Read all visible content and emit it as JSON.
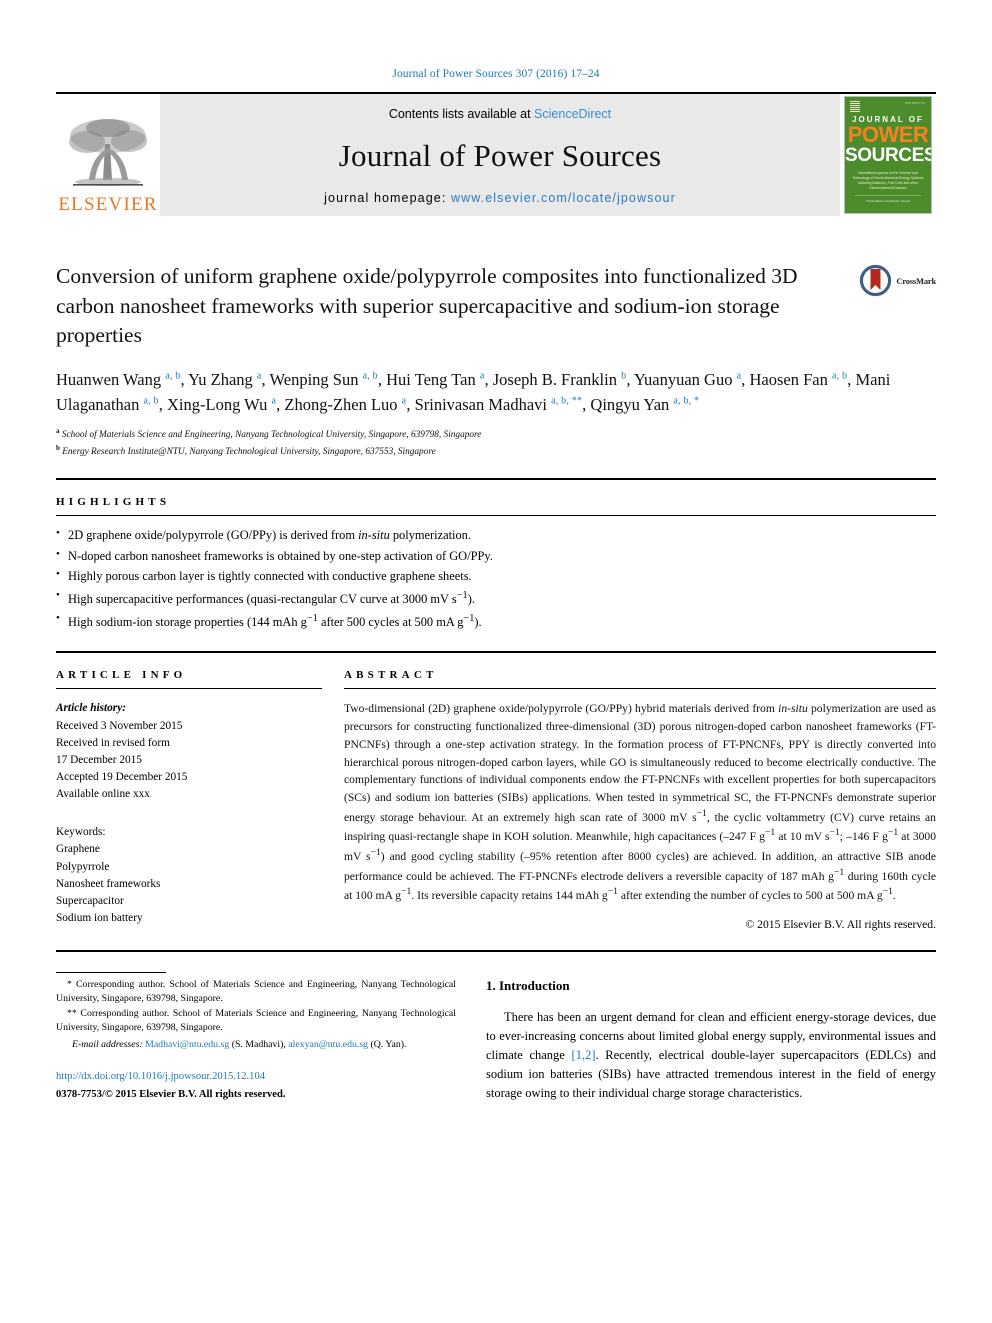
{
  "running_head": "Journal of Power Sources 307 (2016) 17–24",
  "masthead": {
    "publisher_name": "ELSEVIER",
    "contents_prefix": "Contents lists available at ",
    "contents_link": "ScienceDirect",
    "journal_name": "Journal of Power Sources",
    "homepage_prefix": "journal homepage: ",
    "homepage_url": "www.elsevier.com/locate/jpowsour",
    "cover": {
      "line1": "JOURNAL OF",
      "line2": "POWER",
      "line3": "SOURCES",
      "subtitle": "International journal on the Science and Technology of Electrochemical Energy Systems including Batteries, Fuel Cells and other Electrochemical Devices",
      "footer": "ScienceDirect\nAn Elsevier Journal"
    }
  },
  "article": {
    "title": "Conversion of uniform graphene oxide/polypyrrole composites into functionalized 3D carbon nanosheet frameworks with superior supercapacitive and sodium-ion storage properties",
    "crossmark_label": "CrossMark",
    "authors_html": "Huanwen Wang <sup class=\"aff-mark\">a, b</sup>, Yu Zhang <sup class=\"aff-mark\">a</sup>, Wenping Sun <sup class=\"aff-mark\">a, b</sup>, Hui Teng Tan <sup class=\"aff-mark\">a</sup>, Joseph B. Franklin <sup class=\"aff-mark\">b</sup>, Yuanyuan Guo <sup class=\"aff-mark\">a</sup>, Haosen Fan <sup class=\"aff-mark\">a, b</sup>, Mani Ulaganathan <sup class=\"aff-mark\">a, b</sup>, Xing-Long Wu <sup class=\"aff-mark\">a</sup>, Zhong-Zhen Luo <sup class=\"aff-mark\">a</sup>, Srinivasan Madhavi <sup class=\"aff-mark\">a, b, **</sup>, Qingyu Yan <sup class=\"aff-mark\">a, b, *</sup>",
    "affiliations": [
      {
        "mark": "a",
        "text": "School of Materials Science and Engineering, Nanyang Technological University, Singapore, 639798, Singapore"
      },
      {
        "mark": "b",
        "text": "Energy Research Institute@NTU, Nanyang Technological University, Singapore, 637553, Singapore"
      }
    ]
  },
  "highlights": {
    "heading": "HIGHLIGHTS",
    "items_html": [
      "2D graphene oxide/polypyrrole (GO/PPy) is derived from <i>in-situ</i> polymerization.",
      "N-doped carbon nanosheet frameworks is obtained by one-step activation of GO/PPy.",
      "Highly porous carbon layer is tightly connected with conductive graphene sheets.",
      "High supercapacitive performances (quasi-rectangular CV curve at 3000 mV s<sup>−1</sup>).",
      "High sodium-ion storage properties (144 mAh g<sup>−1</sup> after 500 cycles at 500 mA g<sup>−1</sup>)."
    ]
  },
  "article_info": {
    "heading": "ARTICLE INFO",
    "history_label": "Article history:",
    "history_lines": [
      "Received 3 November 2015",
      "Received in revised form",
      "17 December 2015",
      "Accepted 19 December 2015",
      "Available online xxx"
    ],
    "keywords_label": "Keywords:",
    "keywords": [
      "Graphene",
      "Polypyrrole",
      "Nanosheet frameworks",
      "Supercapacitor",
      "Sodium ion battery"
    ]
  },
  "abstract": {
    "heading": "ABSTRACT",
    "body_html": "Two-dimensional (2D) graphene oxide/polypyrrole (GO/PPy) hybrid materials derived from <i>in-situ</i> polymerization are used as precursors for constructing functionalized three-dimensional (3D) porous nitrogen-doped carbon nanosheet frameworks (FT-PNCNFs) through a one-step activation strategy. In the formation process of FT-PNCNFs, PPY is directly converted into hierarchical porous nitrogen-doped carbon layers, while GO is simultaneously reduced to become electrically conductive. The complementary functions of individual components endow the FT-PNCNFs with excellent properties for both supercapacitors (SCs) and sodium ion batteries (SIBs) applications. When tested in symmetrical SC, the FT-PNCNFs demonstrate superior energy storage behaviour. At an extremely high scan rate of 3000 mV s<sup>−1</sup>, the cyclic voltammetry (CV) curve retains an inspiring quasi-rectangle shape in KOH solution. Meanwhile, high capacitances (–247 F g<sup>−1</sup> at 10 mV s<sup>−1</sup>; –146 F g<sup>−1</sup> at 3000 mV s<sup>−1</sup>) and good cycling stability (–95% retention after 8000 cycles) are achieved. In addition, an attractive SIB anode performance could be achieved. The FT-PNCNFs electrode delivers a reversible capacity of 187 mAh g<sup>−1</sup> during 160th cycle at 100 mA g<sup>−1</sup>. Its reversible capacity retains 144 mAh g<sup>−1</sup> after extending the number of cycles to 500 at 500 mA g<sup>−1</sup>.",
    "copyright": "© 2015 Elsevier B.V. All rights reserved."
  },
  "introduction": {
    "heading": "1. Introduction",
    "body_html": "There has been an urgent demand for clean and efficient energy-storage devices, due to ever-increasing concerns about limited global energy supply, environmental issues and climate change <a class=\"cite-link\">[1,2]</a>. Recently, electrical double-layer supercapacitors (EDLCs) and sodium ion batteries (SIBs) have attracted tremendous interest in the field of energy storage owing to their individual charge storage characteristics."
  },
  "footer": {
    "footnote1_mark": "*",
    "footnote1": "Corresponding author. School of Materials Science and Engineering, Nanyang Technological University, Singapore, 639798, Singapore.",
    "footnote2_mark": "**",
    "footnote2": "Corresponding author. School of Materials Science and Engineering, Nanyang Technological University, Singapore, 639798, Singapore.",
    "email_label": "E-mail addresses:",
    "email1": "Madhavi@ntu.edu.sg",
    "email1_owner": "(S. Madhavi),",
    "email2": "alexyan@ntu.edu.sg",
    "email2_owner": "(Q. Yan).",
    "doi": "http://dx.doi.org/10.1016/j.jpowsour.2015.12.104",
    "issn": "0378-7753/© 2015 Elsevier B.V. All rights reserved."
  },
  "colors": {
    "link_blue": "#1b7ab5",
    "elsevier_orange": "#e87722",
    "cover_green": "#4c8c2b",
    "banner_grey": "#e9e9e9"
  }
}
